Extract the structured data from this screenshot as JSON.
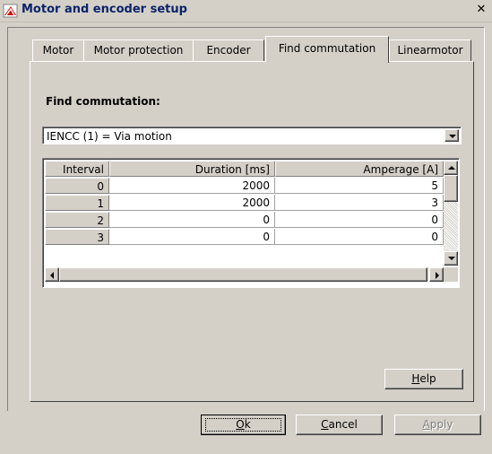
{
  "window": {
    "title": "Motor and encoder setup",
    "close_glyph": "✕"
  },
  "tabs": [
    {
      "label": "Motor",
      "active": false
    },
    {
      "label": "Motor protection",
      "active": false
    },
    {
      "label": "Encoder",
      "active": false
    },
    {
      "label": "Find commutation",
      "active": true
    },
    {
      "label": "Linearmotor",
      "active": false
    }
  ],
  "panel": {
    "section_label": "Find commutation:",
    "mode_select": {
      "value": "IENCC (1) = Via motion"
    }
  },
  "grid": {
    "columns": [
      "Interval",
      "Duration [ms]",
      "Amperage [A]"
    ],
    "rows": [
      {
        "interval": "0",
        "duration": "2000",
        "amperage": "5"
      },
      {
        "interval": "1",
        "duration": "2000",
        "amperage": "3"
      },
      {
        "interval": "2",
        "duration": "0",
        "amperage": "0"
      },
      {
        "interval": "3",
        "duration": "0",
        "amperage": "0"
      }
    ]
  },
  "buttons": {
    "help": {
      "prefix": "",
      "mnemonic": "H",
      "rest": "elp"
    },
    "ok": {
      "prefix": "",
      "mnemonic": "O",
      "rest": "k"
    },
    "cancel": {
      "prefix": "",
      "mnemonic": "C",
      "rest": "ancel"
    },
    "apply": {
      "prefix": "",
      "mnemonic": "A",
      "rest": "pply"
    }
  },
  "icons": {
    "app": "app-icon",
    "close": "close-icon",
    "dropdown": "chevron-down-icon"
  },
  "colors": {
    "title_text": "#0a246a",
    "face": "#d4d0c8",
    "disabled_text": "#808080"
  }
}
